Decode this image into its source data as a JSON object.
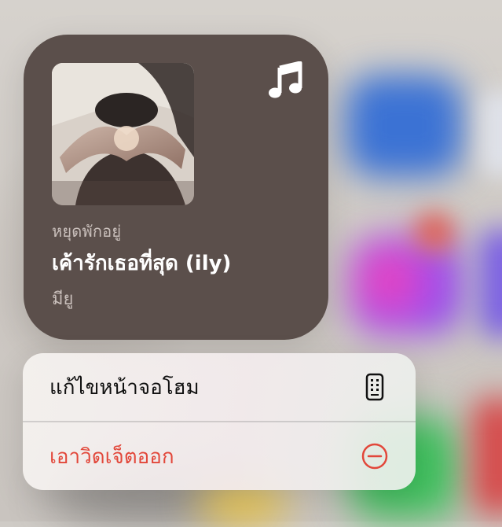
{
  "widget": {
    "status": "หยุดพักอยู่",
    "song_title": "เค้ารักเธอที่สุด (ily)",
    "artist": "มียู",
    "background_color": "#5b4f4b",
    "icon": "music-note-icon"
  },
  "context_menu": {
    "items": [
      {
        "label": "แก้ไขหน้าจอโฮม",
        "icon": "phone-icon",
        "color": "#111111"
      },
      {
        "label": "เอาวิดเจ็ตออก",
        "icon": "minus-circle-icon",
        "color": "#e2473a"
      }
    ]
  }
}
